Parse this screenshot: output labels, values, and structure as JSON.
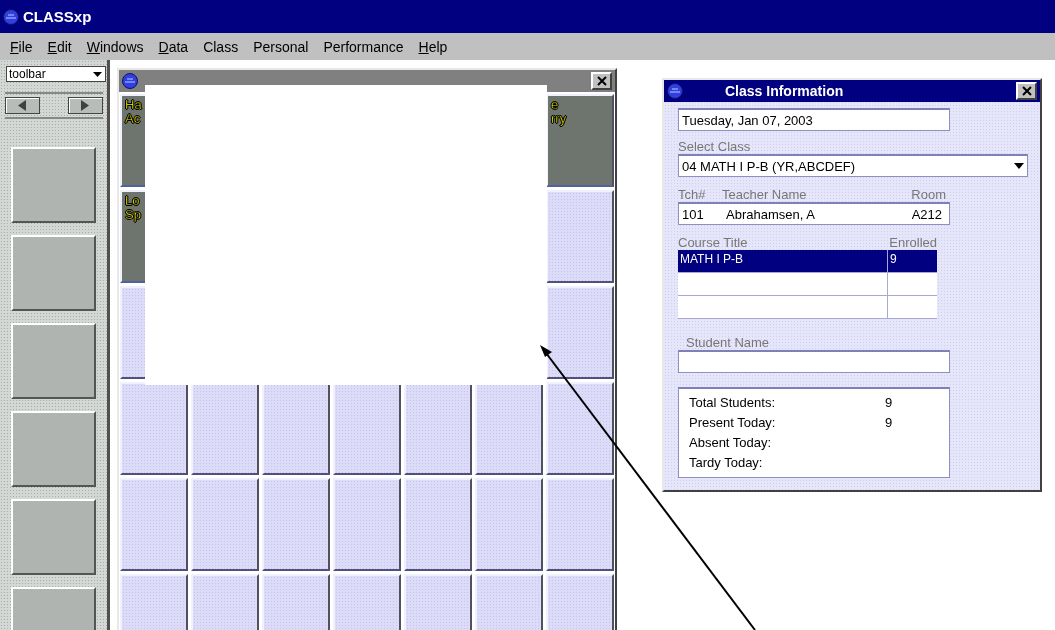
{
  "app": {
    "title": "CLASSxp"
  },
  "menu": [
    {
      "label": "File",
      "mnemonic": true
    },
    {
      "label": "Edit",
      "mnemonic": true
    },
    {
      "label": "Windows",
      "mnemonic": true
    },
    {
      "label": "Data",
      "mnemonic": true
    },
    {
      "label": "Class",
      "mnemonic": false
    },
    {
      "label": "Personal",
      "mnemonic": false
    },
    {
      "label": "Performance",
      "mnemonic": false
    },
    {
      "label": "Help",
      "mnemonic": true
    }
  ],
  "toolbar": {
    "selector": "toolbar"
  },
  "seating_chart": {
    "rows": [
      {
        "seats": [
          {
            "occupied": true,
            "name_lines": [
              "Ha",
              "Ac"
            ]
          },
          {
            "occupied": true,
            "name_lines": [
              "e",
              "rry"
            ]
          }
        ]
      },
      {
        "seats": [
          {
            "occupied": true,
            "name_lines": [
              "Lo",
              "Sp"
            ]
          },
          {
            "occupied": false
          }
        ]
      },
      {
        "seats": [
          {
            "occupied": false
          },
          {
            "occupied": false
          }
        ]
      },
      {
        "seats": [
          {
            "occupied": false
          },
          {
            "occupied": false
          },
          {
            "occupied": false
          },
          {
            "occupied": false
          },
          {
            "occupied": false
          },
          {
            "occupied": false
          },
          {
            "occupied": false
          }
        ]
      },
      {
        "seats": [
          {
            "occupied": false
          },
          {
            "occupied": false
          },
          {
            "occupied": false
          },
          {
            "occupied": false
          },
          {
            "occupied": false
          },
          {
            "occupied": false
          },
          {
            "occupied": false
          }
        ]
      },
      {
        "seats": [
          {
            "occupied": false
          },
          {
            "occupied": false
          },
          {
            "occupied": false
          },
          {
            "occupied": false
          },
          {
            "occupied": false
          },
          {
            "occupied": false
          },
          {
            "occupied": false
          }
        ]
      }
    ]
  },
  "class_info": {
    "title": "Class Information",
    "date": "Tuesday, Jan 07, 2003",
    "select_class_label": "Select Class",
    "select_class_value": "04 MATH I P-B (YR,ABCDEF)",
    "teacher_headers": [
      "Tch#",
      "Teacher Name",
      "Room"
    ],
    "teacher": {
      "number": "101",
      "name": "Abrahamsen, A",
      "room": "A212"
    },
    "course_headers": [
      "Course Title",
      "Enrolled"
    ],
    "courses": [
      {
        "title": "MATH I P-B",
        "enrolled": "9",
        "selected": true
      }
    ],
    "student_name_label": "Student Name",
    "stats": [
      {
        "label": "Total Students:",
        "value": "9"
      },
      {
        "label": "Present Today:",
        "value": "9"
      },
      {
        "label": "Absent Today:"
      },
      {
        "label": "Tardy Today:"
      }
    ]
  }
}
